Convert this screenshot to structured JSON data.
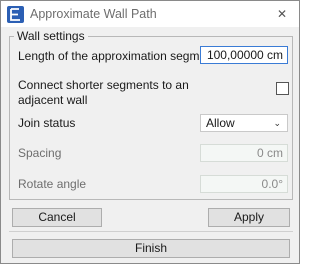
{
  "window": {
    "title": "Approximate Wall Path",
    "app_icon": "app-logo-icon",
    "close_icon": "close-icon",
    "close_glyph": "✕"
  },
  "group": {
    "title": "Wall settings"
  },
  "fields": {
    "segment_length": {
      "label": "Length of the approximation segment",
      "value": "100,00000 cm"
    },
    "connect_shorter": {
      "label_line1": "Connect shorter segments to an",
      "label_line2": "adjacent wall",
      "checked": false
    },
    "join_status": {
      "label": "Join status",
      "value": "Allow",
      "chevron_icon": "chevron-down-icon",
      "chevron_glyph": "⌄"
    },
    "spacing": {
      "label": "Spacing",
      "value": "0 cm"
    },
    "rotate_angle": {
      "label": "Rotate angle",
      "value": "0.0°"
    }
  },
  "buttons": {
    "cancel": "Cancel",
    "apply": "Apply",
    "finish": "Finish"
  },
  "colors": {
    "accent": "#3a7bd5",
    "icon_blue": "#2b5fb4"
  }
}
